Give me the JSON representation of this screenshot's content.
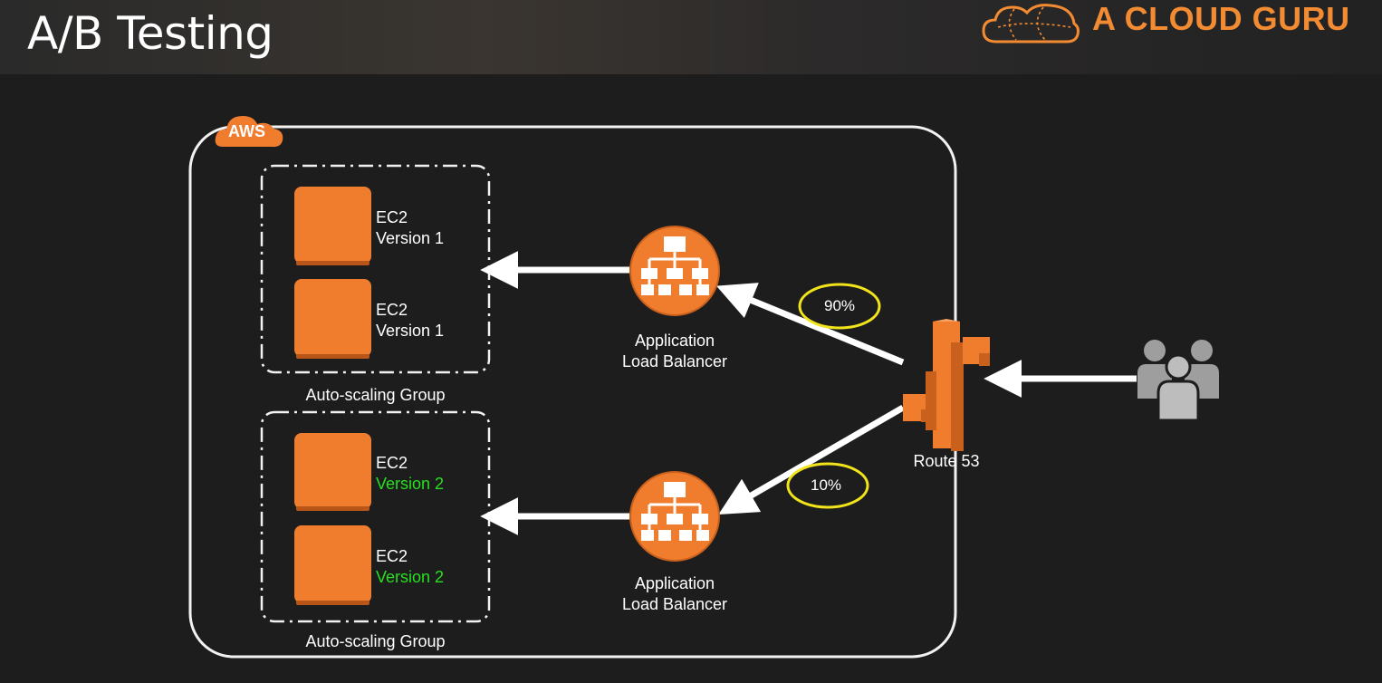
{
  "header": {
    "title": "A/B Testing",
    "brand": "A CLOUD GURU",
    "brand_color": "#f38b32"
  },
  "diagram": {
    "cloud_label": "AWS",
    "groups": [
      {
        "label": "Auto-scaling Group",
        "instances": [
          {
            "name": "EC2",
            "version": "Version 1"
          },
          {
            "name": "EC2",
            "version": "Version 1"
          }
        ]
      },
      {
        "label": "Auto-scaling Group",
        "instances": [
          {
            "name": "EC2",
            "version": "Version 2"
          },
          {
            "name": "EC2",
            "version": "Version 2"
          }
        ]
      }
    ],
    "load_balancers": [
      {
        "line1": "Application",
        "line2": "Load Balancer"
      },
      {
        "line1": "Application",
        "line2": "Load Balancer"
      }
    ],
    "route53_label": "Route 53",
    "traffic_split": {
      "top": "90%",
      "bottom": "10%"
    },
    "colors": {
      "aws_orange": "#f07d2e",
      "highlight_green": "#26e01e",
      "annotation_yellow": "#f2e41a",
      "users_gray": "#9e9e9e"
    },
    "icons": [
      "aws-cloud-icon",
      "ec2-instance-icon",
      "load-balancer-icon",
      "route53-icon",
      "users-icon"
    ]
  }
}
